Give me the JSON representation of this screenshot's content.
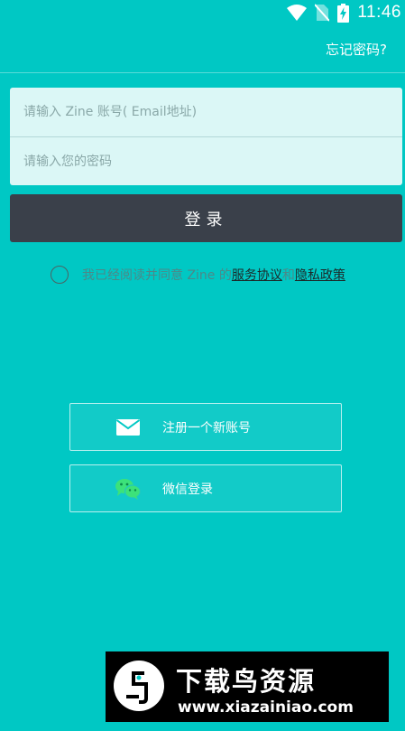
{
  "status_bar": {
    "time": "11:46",
    "icons": [
      "wifi-icon",
      "no-sim-icon",
      "battery-charging-icon"
    ]
  },
  "header": {
    "forgot_password": "忘记密码?"
  },
  "form": {
    "account_placeholder": "请输入 Zine 账号( Email地址)",
    "password_placeholder": "请输入您的密码",
    "login_label": "登录"
  },
  "agreement": {
    "prefix": "我已经阅读并同意 Zine 的",
    "terms_link": "服务协议",
    "conjunction": "和",
    "privacy_link": "隐私政策",
    "checked": false
  },
  "options": {
    "register": {
      "label": "注册一个新账号",
      "icon": "mail-icon"
    },
    "wechat": {
      "label": "微信登录",
      "icon": "wechat-icon"
    }
  },
  "watermark": {
    "title": "下载鸟资源",
    "url": "www.xiazainiao.com"
  },
  "colors": {
    "background": "#00c8c4",
    "login_button": "#3a404a",
    "input_background": "#dbf7f6",
    "wechat_green": "#3ce27a"
  }
}
